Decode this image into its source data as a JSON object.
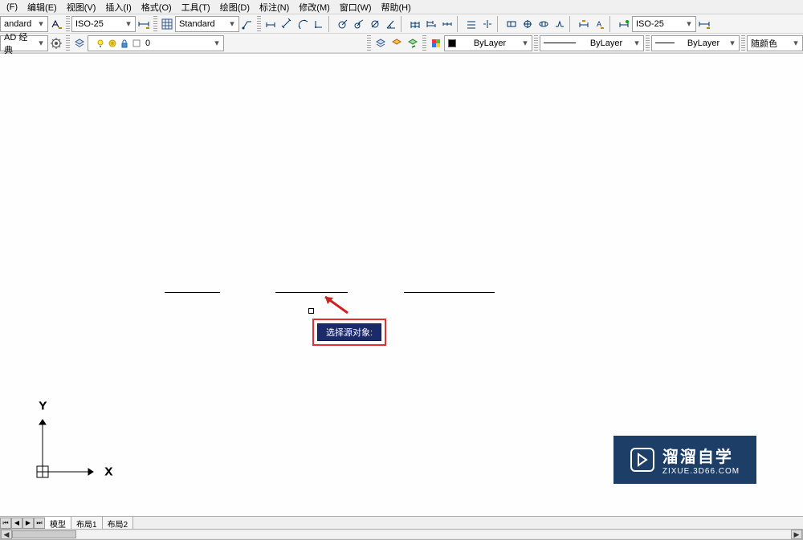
{
  "menu": {
    "file": "(F)",
    "edit": "编辑(E)",
    "view": "视图(V)",
    "insert": "插入(I)",
    "format": "格式(O)",
    "tools": "工具(T)",
    "draw": "绘图(D)",
    "dimension": "标注(N)",
    "modify": "修改(M)",
    "window": "窗口(W)",
    "help": "帮助(H)"
  },
  "toolbar1": {
    "style1": "andard",
    "style2": "ISO-25",
    "style3": "Standard",
    "style4": "ISO-25"
  },
  "toolbar2": {
    "workspace": "AD 经典",
    "layer": "0",
    "colorByLayer": "ByLayer",
    "linetypeByLayer": "ByLayer",
    "lineweightByLayer": "ByLayer",
    "plotstyle": "随颜色"
  },
  "tooltip": {
    "text": "选择源对象:"
  },
  "tabs": {
    "model": "模型",
    "layout1": "布局1",
    "layout2": "布局2"
  },
  "ucs": {
    "x": "X",
    "y": "Y"
  },
  "watermark": {
    "title": "溜溜自学",
    "url": "ZIXUE.3D66.COM"
  }
}
